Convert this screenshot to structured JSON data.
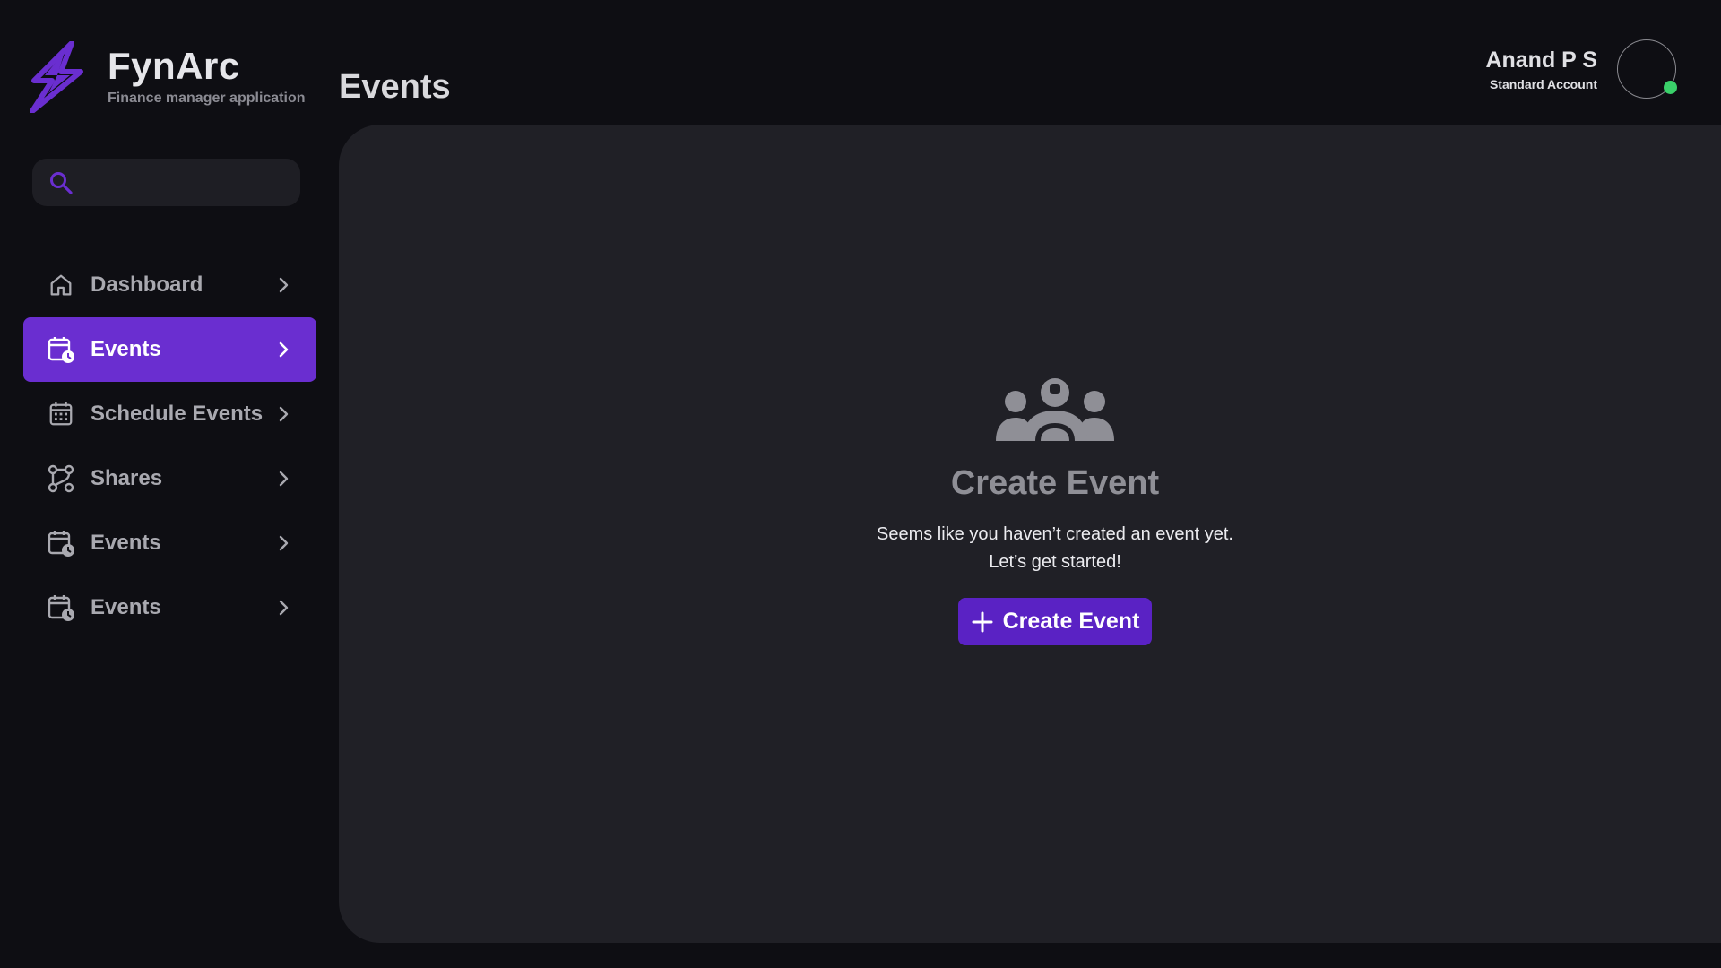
{
  "brand": {
    "name": "FynArc",
    "tagline": "Finance manager application",
    "logo_icon": "lightning-bolt-icon",
    "accent_color": "#6a2ed0"
  },
  "header": {
    "page_title": "Events"
  },
  "user": {
    "name": "Anand P S",
    "role": "Standard Account",
    "status_color": "#3ad06a"
  },
  "search": {
    "placeholder": "",
    "value": "",
    "icon": "search-icon"
  },
  "sidebar": {
    "items": [
      {
        "label": "Dashboard",
        "icon": "home-icon",
        "active": false
      },
      {
        "label": "Events",
        "icon": "calendar-clock-icon",
        "active": true
      },
      {
        "label": "Schedule Events",
        "icon": "calendar-grid-icon",
        "active": false
      },
      {
        "label": "Shares",
        "icon": "share-nodes-icon",
        "active": false
      },
      {
        "label": "Events",
        "icon": "calendar-clock-icon",
        "active": false
      },
      {
        "label": "Events",
        "icon": "calendar-clock-icon",
        "active": false
      }
    ]
  },
  "empty_state": {
    "icon": "group-users-icon",
    "title": "Create Event",
    "description_line1": "Seems like you haven’t created an event yet.",
    "description_line2": "Let’s get started!",
    "button_label": "Create Event",
    "button_icon": "plus-icon",
    "button_color": "#5a22c4"
  }
}
